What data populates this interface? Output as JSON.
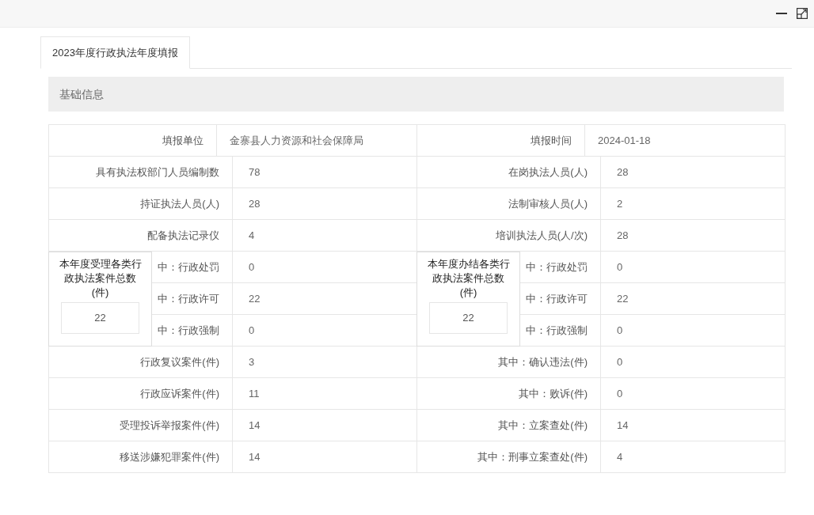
{
  "tabs": [
    {
      "label": "2023年度行政执法年度填报",
      "selected": true
    }
  ],
  "section": {
    "title": "基础信息"
  },
  "header_row": {
    "left": {
      "label": "填报单位",
      "value": "金寨县人力资源和社会保障局"
    },
    "right": {
      "label": "填报时间",
      "value": "2024-01-18"
    }
  },
  "rows": [
    {
      "left": {
        "label": "具有执法权部门人员编制数",
        "value": "78"
      },
      "right": {
        "label": "在岗执法人员(人)",
        "value": "28"
      }
    },
    {
      "left": {
        "label": "持证执法人员(人)",
        "value": "28"
      },
      "right": {
        "label": "法制审核人员(人)",
        "value": "2"
      }
    },
    {
      "left": {
        "label": "配备执法记录仪",
        "value": "4"
      },
      "right": {
        "label": "培训执法人员(人/次)",
        "value": "28"
      }
    },
    {
      "left": {
        "label": "中：行政处罚",
        "value": "0"
      },
      "right": {
        "label": "中：行政处罚",
        "value": "0"
      }
    },
    {
      "left": {
        "label": "中：行政许可",
        "value": "22"
      },
      "right": {
        "label": "中：行政许可",
        "value": "22"
      }
    },
    {
      "left": {
        "label": "中：行政强制",
        "value": "0"
      },
      "right": {
        "label": "中：行政强制",
        "value": "0"
      }
    },
    {
      "left": {
        "label": "行政复议案件(件)",
        "value": "3"
      },
      "right": {
        "label": "其中：确认违法(件)",
        "value": "0"
      }
    },
    {
      "left": {
        "label": "行政应诉案件(件)",
        "value": "11"
      },
      "right": {
        "label": "其中：败诉(件)",
        "value": "0"
      }
    },
    {
      "left": {
        "label": "受理投诉举报案件(件)",
        "value": "14"
      },
      "right": {
        "label": "其中：立案查处(件)",
        "value": "14"
      }
    },
    {
      "left": {
        "label": "移送涉嫌犯罪案件(件)",
        "value": "14"
      },
      "right": {
        "label": "其中：刑事立案查处(件)",
        "value": "4"
      }
    }
  ],
  "case_totals": [
    {
      "title": "本年度受理各类行政执法案件总数(件)",
      "value": "22"
    },
    {
      "title": "本年度办结各类行政执法案件总数(件)",
      "value": "22"
    }
  ]
}
